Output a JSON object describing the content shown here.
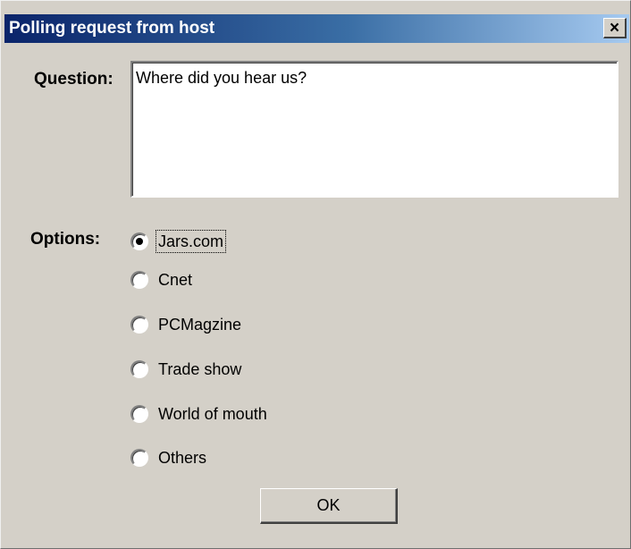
{
  "window": {
    "title": "Polling request from host",
    "close_glyph": "×",
    "close_icon": "close-icon"
  },
  "question": {
    "label": "Question:",
    "text": "Where did you hear us?"
  },
  "options": {
    "label": "Options:",
    "selected_index": 0,
    "items": [
      {
        "label": "Jars.com",
        "checked": true
      },
      {
        "label": "Cnet",
        "checked": false
      },
      {
        "label": "PCMagzine",
        "checked": false
      },
      {
        "label": "Trade show",
        "checked": false
      },
      {
        "label": "World of mouth",
        "checked": false
      },
      {
        "label": "Others",
        "checked": false
      }
    ]
  },
  "buttons": {
    "ok_label": "OK"
  },
  "colors": {
    "dialog_face": "#d4d0c8",
    "title_bar_start": "#0a246a",
    "title_bar_end": "#a6caf0"
  }
}
